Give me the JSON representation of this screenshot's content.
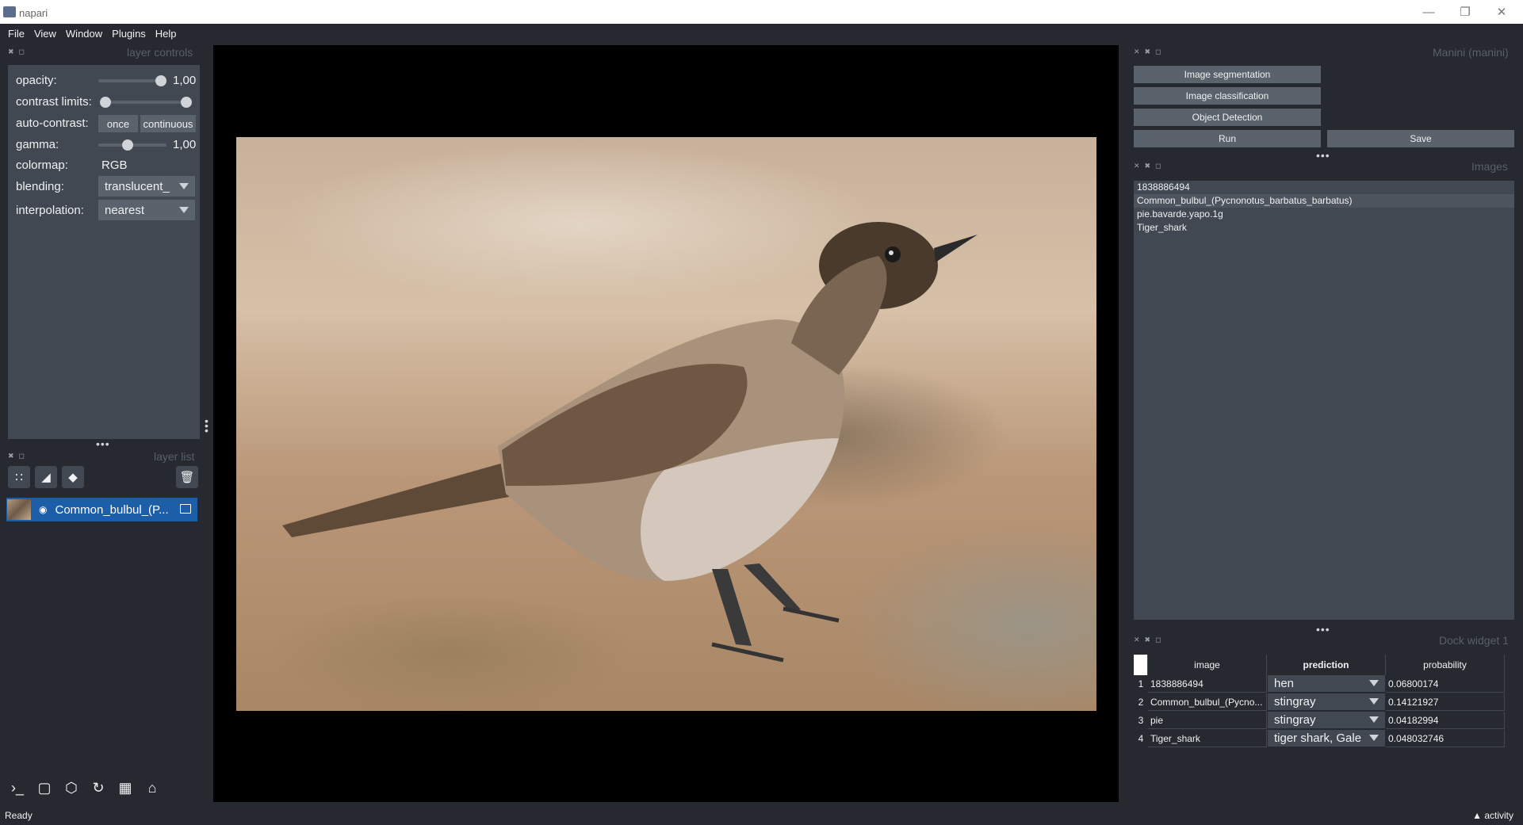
{
  "window": {
    "title": "napari"
  },
  "menu": [
    "File",
    "View",
    "Window",
    "Plugins",
    "Help"
  ],
  "layer_controls": {
    "title": "layer controls",
    "opacity_label": "opacity:",
    "opacity_value": "1,00",
    "contrast_label": "contrast limits:",
    "autocontrast_label": "auto-contrast:",
    "once_label": "once",
    "continuous_label": "continuous",
    "gamma_label": "gamma:",
    "gamma_value": "1,00",
    "colormap_label": "colormap:",
    "colormap_value": "RGB",
    "blending_label": "blending:",
    "blending_value": "translucent_",
    "interpolation_label": "interpolation:",
    "interpolation_value": "nearest"
  },
  "layer_list": {
    "title": "layer list",
    "layers": [
      {
        "name": "Common_bulbul_(P..."
      }
    ]
  },
  "manini": {
    "title": "Manini (manini)",
    "seg_label": "Image segmentation",
    "class_label": "Image classification",
    "det_label": "Object Detection",
    "run_label": "Run",
    "save_label": "Save"
  },
  "images": {
    "title": "Images",
    "items": [
      "1838886494",
      "Common_bulbul_(Pycnonotus_barbatus_barbatus)",
      "pie.bavarde.yapo.1g",
      "Tiger_shark"
    ]
  },
  "dock_widget": {
    "title": "Dock widget 1",
    "headers": [
      "image",
      "prediction",
      "probability"
    ],
    "rows": [
      {
        "n": "1",
        "image": "1838886494",
        "prediction": "hen",
        "probability": "0.06800174"
      },
      {
        "n": "2",
        "image": "Common_bulbul_(Pycno...",
        "prediction": "stingray",
        "probability": "0.14121927"
      },
      {
        "n": "3",
        "image": "pie",
        "prediction": "stingray",
        "probability": "0.04182994"
      },
      {
        "n": "4",
        "image": "Tiger_shark",
        "prediction": "tiger shark, Gale",
        "probability": "0.048032746"
      }
    ]
  },
  "status": {
    "text": "Ready",
    "activity": "activity"
  }
}
